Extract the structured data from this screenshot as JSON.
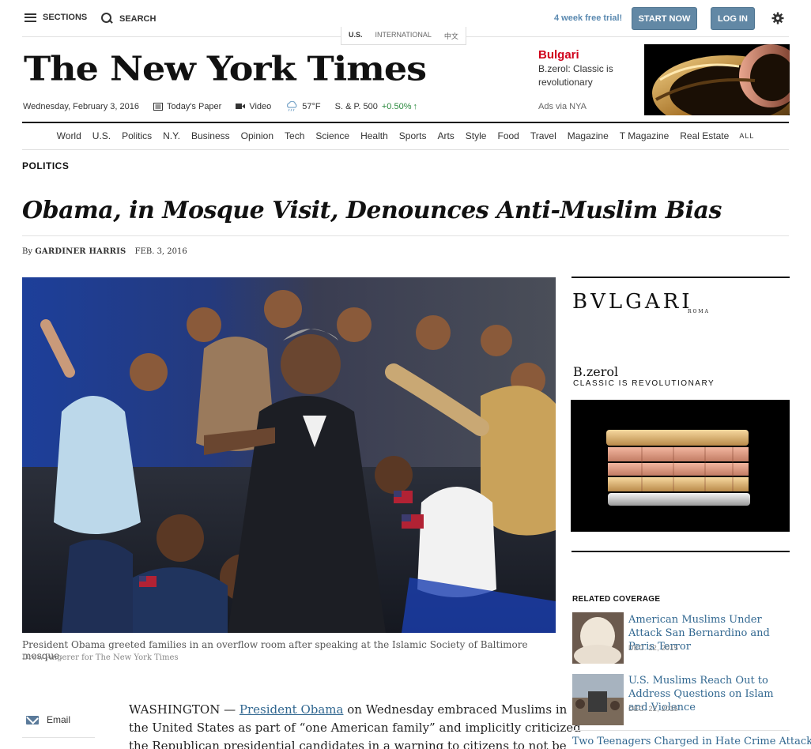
{
  "topbar": {
    "sections_label": "SECTIONS",
    "search_label": "SEARCH",
    "trial_text": "4 week free trial!",
    "start_now_label": "START NOW",
    "login_label": "LOG IN"
  },
  "editions": [
    "U.S.",
    "INTERNATIONAL",
    "中文"
  ],
  "masthead": "The New York Times",
  "dateline": {
    "date": "Wednesday, February 3, 2016",
    "todays_paper": "Today's Paper",
    "video": "Video",
    "temperature": "57°F",
    "index_name": "S. & P. 500",
    "index_change": "+0.50%",
    "index_arrow": "↑"
  },
  "top_ad": {
    "brand": "Bulgari",
    "copy": "B.zerol: Classic is revolutionary",
    "via": "Ads via NYA"
  },
  "nav": [
    "World",
    "U.S.",
    "Politics",
    "N.Y.",
    "Business",
    "Opinion",
    "Tech",
    "Science",
    "Health",
    "Sports",
    "Arts",
    "Style",
    "Food",
    "Travel",
    "Magazine",
    "T Magazine",
    "Real Estate"
  ],
  "nav_all": "ALL",
  "article": {
    "kicker": "POLITICS",
    "headline": "Obama, in Mosque Visit, Denounces Anti-Muslim Bias",
    "by_prefix": "By",
    "author": "GARDINER HARRIS",
    "date": "FEB. 3, 2016",
    "caption": "President Obama greeted families in an overflow room after speaking at the Islamic Society of Baltimore mosque.",
    "credit": "Drew Angerer for The New York Times",
    "lead_place": "WASHINGTON —",
    "lead_link": "President Obama",
    "lead_rest_1": "on Wednesday embraced Muslims in",
    "lead_line_2": "the United States as part of “one American family” and implicitly criticized",
    "lead_line_3": "the Republican presidential candidates in a warning to citizens to not be"
  },
  "share": {
    "email_label": "Email"
  },
  "side_ad": {
    "brand": "BVLGARI",
    "sub": "ROMA",
    "product": "B.zerol",
    "tagline": "CLASSIC IS REVOLUTIONARY"
  },
  "related": {
    "title": "RELATED COVERAGE",
    "items": [
      {
        "headline": "American Muslims Under Attack San Bernardino and Paris Terror",
        "date": "DEC. 22, 2015"
      },
      {
        "headline": "U.S. Muslims Reach Out to Address Questions on Islam and Violence",
        "date": "DEC. 22, 2015"
      },
      {
        "headline": "Two Teenagers Charged in Hate Crime Attack"
      }
    ]
  },
  "colors": {
    "accent_blue": "#6288a5",
    "link_blue": "#326891",
    "ad_red": "#d0021b",
    "market_green": "#2b8a3e"
  }
}
